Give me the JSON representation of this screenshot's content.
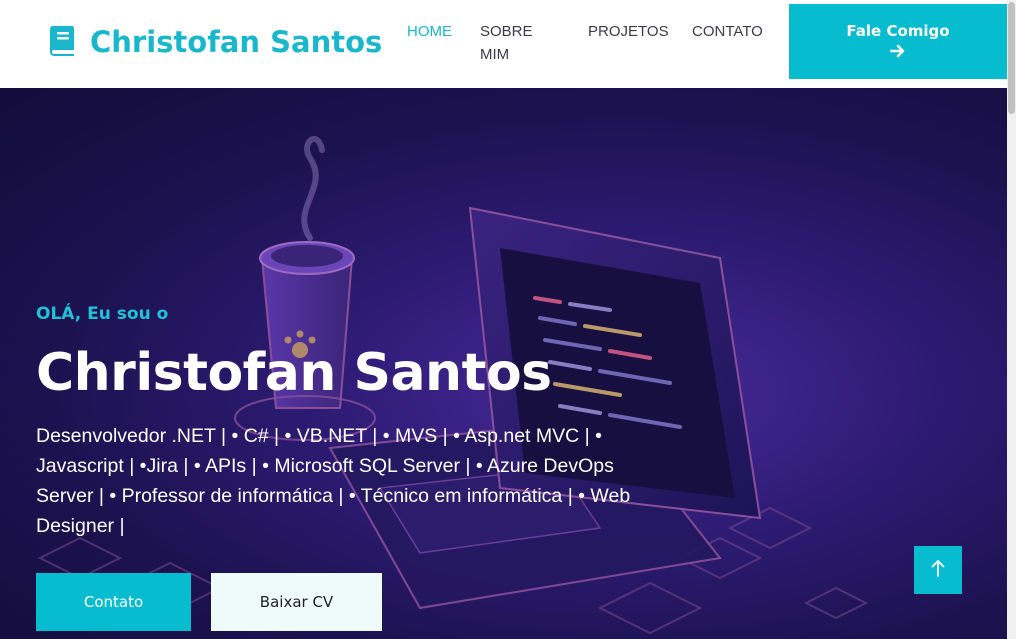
{
  "header": {
    "brand_name": "Christofan Santos",
    "brand_icon": "book-icon",
    "nav": [
      {
        "label": "HOME",
        "active": true
      },
      {
        "label": "SOBRE MIM",
        "active": false
      },
      {
        "label": "PROJETOS",
        "active": false
      },
      {
        "label": "CONTATO",
        "active": false
      }
    ],
    "cta_label": "Fale Comigo",
    "cta_icon": "arrow-right-icon"
  },
  "hero": {
    "greeting": "OLÁ, Eu sou o",
    "name": "Christofan Santos",
    "description": "Desenvolvedor .NET | • C# | • VB.NET | • MVS | • Asp.net MVC | • Javascript | •Jira | • APIs | • Microsoft SQL Server | • Azure DevOps Server | • Professor de informática | • Técnico em informática | • Web Designer |",
    "buttons": {
      "contato": "Contato",
      "cv": "Baixar CV"
    },
    "background_image": "laptop-coffee-illustration"
  },
  "scroll_top_icon": "arrow-up-icon",
  "colors": {
    "accent": "#08bccf",
    "nav_text": "#3b3b48",
    "hero_bg": "#2d1b73",
    "cv_button_bg": "#effbfb"
  }
}
